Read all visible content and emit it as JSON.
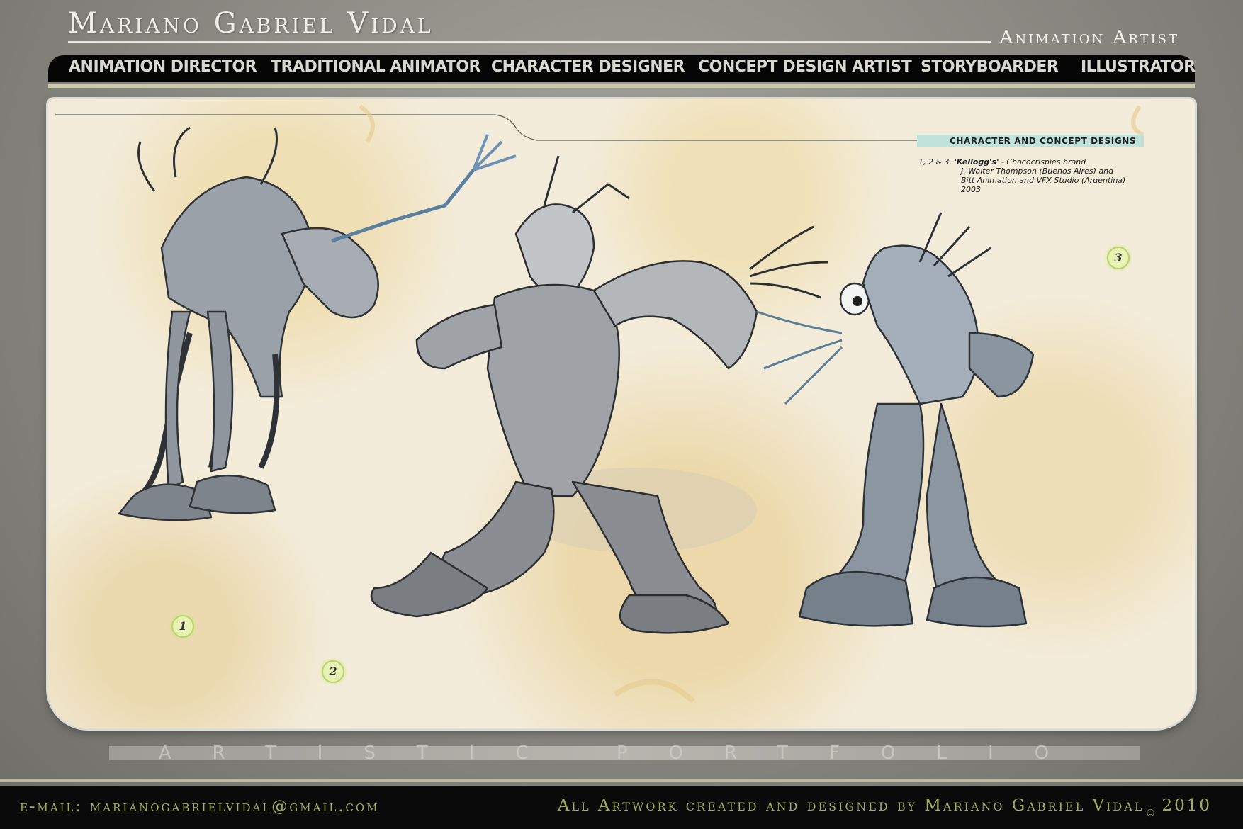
{
  "header": {
    "title": "Mariano Gabriel Vidal",
    "subtitle": "Animation Artist"
  },
  "nav": {
    "items": [
      {
        "label": "ANIMATION DIRECTOR"
      },
      {
        "label": "TRADITIONAL ANIMATOR"
      },
      {
        "label": "CHARACTER DESIGNER"
      },
      {
        "label": "CONCEPT DESIGN ARTIST"
      },
      {
        "label": "STORYBOARDER"
      },
      {
        "label": "ILLUSTRATOR"
      }
    ]
  },
  "panel": {
    "section_label": "CHARACTER AND CONCEPT DESIGNS",
    "credits": {
      "prefix": "1, 2 & 3.",
      "client": "'Kellogg's'",
      "line1_rest": " - Chococrispies brand",
      "line2": "J. Walter Thompson (Buenos Aires) and",
      "line3": "Bitt Animation and VFX Studio (Argentina)",
      "line4": "2003"
    },
    "badges": [
      "1",
      "2",
      "3"
    ]
  },
  "portfolio_band": "artistic portfolio",
  "footer": {
    "email": "e-mail: marianogabrielvidal@gmail.com",
    "credit": "All Artwork created and designed by Mariano Gabriel Vidal",
    "copyright": "©",
    "year": "2010"
  },
  "colors": {
    "nav_bg": "#050505",
    "nav_text": "#d8d7d0",
    "footer_text": "#a0b057",
    "tag_bg": "#bfe3da",
    "badge_bg": "#e7f2b4"
  }
}
